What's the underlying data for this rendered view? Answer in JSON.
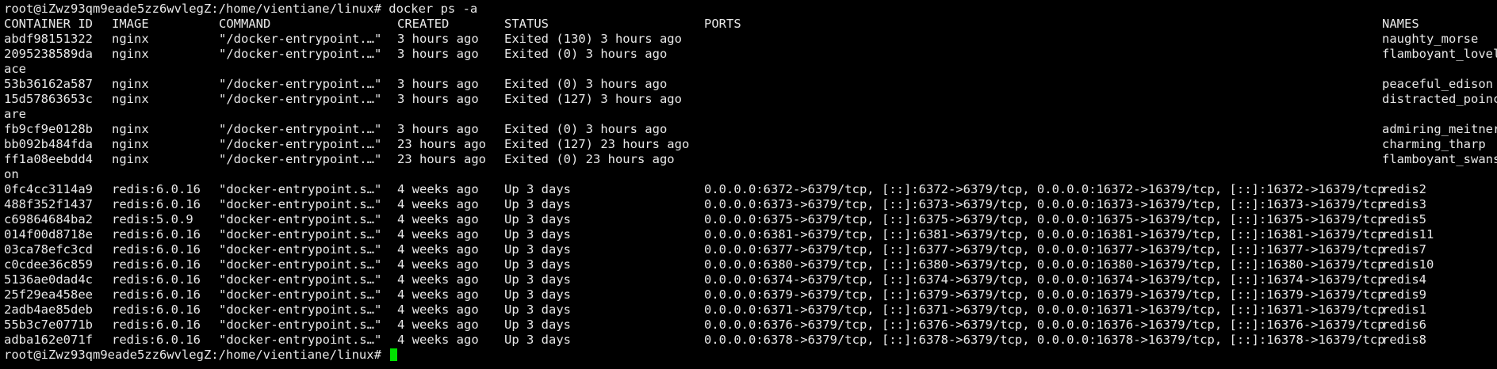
{
  "colors": {
    "background": "#000000",
    "foreground": "#e8e8e8",
    "cursor": "#00e000"
  },
  "prompt": "root@iZwz93qm9eade5zz6wvlegZ:/home/vientiane/linux#",
  "command": "docker ps -a",
  "headers": {
    "id": "CONTAINER ID",
    "image": "IMAGE",
    "command": "COMMAND",
    "created": "CREATED",
    "status": "STATUS",
    "ports": "PORTS",
    "names": "NAMES"
  },
  "rows": [
    {
      "id": "abdf98151322",
      "image": "nginx",
      "command": "\"/docker-entrypoint.…\"",
      "created": "3 hours ago",
      "status": "Exited (130) 3 hours ago",
      "ports": "",
      "names": "naughty_morse",
      "wrap": ""
    },
    {
      "id": "2095238589da",
      "image": "nginx",
      "command": "\"/docker-entrypoint.…\"",
      "created": "3 hours ago",
      "status": "Exited (0) 3 hours ago",
      "ports": "",
      "names": "flamboyant_lovel",
      "wrap": "ace"
    },
    {
      "id": "53b36162a587",
      "image": "nginx",
      "command": "\"/docker-entrypoint.…\"",
      "created": "3 hours ago",
      "status": "Exited (0) 3 hours ago",
      "ports": "",
      "names": "peaceful_edison",
      "wrap": ""
    },
    {
      "id": "15d57863653c",
      "image": "nginx",
      "command": "\"/docker-entrypoint.…\"",
      "created": "3 hours ago",
      "status": "Exited (127) 3 hours ago",
      "ports": "",
      "names": "distracted_poinc",
      "wrap": "are"
    },
    {
      "id": "fb9cf9e0128b",
      "image": "nginx",
      "command": "\"/docker-entrypoint.…\"",
      "created": "3 hours ago",
      "status": "Exited (0) 3 hours ago",
      "ports": "",
      "names": "admiring_meitner",
      "wrap": ""
    },
    {
      "id": "bb092b484fda",
      "image": "nginx",
      "command": "\"/docker-entrypoint.…\"",
      "created": "23 hours ago",
      "status": "Exited (127) 23 hours ago",
      "ports": "",
      "names": "charming_tharp",
      "wrap": ""
    },
    {
      "id": "ff1a08eebdd4",
      "image": "nginx",
      "command": "\"/docker-entrypoint.…\"",
      "created": "23 hours ago",
      "status": "Exited (0) 23 hours ago",
      "ports": "",
      "names": "flamboyant_swans",
      "wrap": "on"
    },
    {
      "id": "0fc4cc3114a9",
      "image": "redis:6.0.16",
      "command": "\"docker-entrypoint.s…\"",
      "created": "4 weeks ago",
      "status": "Up 3 days",
      "ports": "0.0.0.0:6372->6379/tcp, [::]:6372->6379/tcp, 0.0.0.0:16372->16379/tcp, [::]:16372->16379/tcp",
      "names": "redis2",
      "wrap": ""
    },
    {
      "id": "488f352f1437",
      "image": "redis:6.0.16",
      "command": "\"docker-entrypoint.s…\"",
      "created": "4 weeks ago",
      "status": "Up 3 days",
      "ports": "0.0.0.0:6373->6379/tcp, [::]:6373->6379/tcp, 0.0.0.0:16373->16379/tcp, [::]:16373->16379/tcp",
      "names": "redis3",
      "wrap": ""
    },
    {
      "id": "c69864684ba2",
      "image": "redis:5.0.9",
      "command": "\"docker-entrypoint.s…\"",
      "created": "4 weeks ago",
      "status": "Up 3 days",
      "ports": "0.0.0.0:6375->6379/tcp, [::]:6375->6379/tcp, 0.0.0.0:16375->16379/tcp, [::]:16375->16379/tcp",
      "names": "redis5",
      "wrap": ""
    },
    {
      "id": "014f00d8718e",
      "image": "redis:6.0.16",
      "command": "\"docker-entrypoint.s…\"",
      "created": "4 weeks ago",
      "status": "Up 3 days",
      "ports": "0.0.0.0:6381->6379/tcp, [::]:6381->6379/tcp, 0.0.0.0:16381->16379/tcp, [::]:16381->16379/tcp",
      "names": "redis11",
      "wrap": ""
    },
    {
      "id": "03ca78efc3cd",
      "image": "redis:6.0.16",
      "command": "\"docker-entrypoint.s…\"",
      "created": "4 weeks ago",
      "status": "Up 3 days",
      "ports": "0.0.0.0:6377->6379/tcp, [::]:6377->6379/tcp, 0.0.0.0:16377->16379/tcp, [::]:16377->16379/tcp",
      "names": "redis7",
      "wrap": ""
    },
    {
      "id": "c0cdee36c859",
      "image": "redis:6.0.16",
      "command": "\"docker-entrypoint.s…\"",
      "created": "4 weeks ago",
      "status": "Up 3 days",
      "ports": "0.0.0.0:6380->6379/tcp, [::]:6380->6379/tcp, 0.0.0.0:16380->16379/tcp, [::]:16380->16379/tcp",
      "names": "redis10",
      "wrap": ""
    },
    {
      "id": "5136ae0dad4c",
      "image": "redis:6.0.16",
      "command": "\"docker-entrypoint.s…\"",
      "created": "4 weeks ago",
      "status": "Up 3 days",
      "ports": "0.0.0.0:6374->6379/tcp, [::]:6374->6379/tcp, 0.0.0.0:16374->16379/tcp, [::]:16374->16379/tcp",
      "names": "redis4",
      "wrap": ""
    },
    {
      "id": "25f29ea458ee",
      "image": "redis:6.0.16",
      "command": "\"docker-entrypoint.s…\"",
      "created": "4 weeks ago",
      "status": "Up 3 days",
      "ports": "0.0.0.0:6379->6379/tcp, [::]:6379->6379/tcp, 0.0.0.0:16379->16379/tcp, [::]:16379->16379/tcp",
      "names": "redis9",
      "wrap": ""
    },
    {
      "id": "2adb4ae85deb",
      "image": "redis:6.0.16",
      "command": "\"docker-entrypoint.s…\"",
      "created": "4 weeks ago",
      "status": "Up 3 days",
      "ports": "0.0.0.0:6371->6379/tcp, [::]:6371->6379/tcp, 0.0.0.0:16371->16379/tcp, [::]:16371->16379/tcp",
      "names": "redis1",
      "wrap": ""
    },
    {
      "id": "55b3c7e0771b",
      "image": "redis:6.0.16",
      "command": "\"docker-entrypoint.s…\"",
      "created": "4 weeks ago",
      "status": "Up 3 days",
      "ports": "0.0.0.0:6376->6379/tcp, [::]:6376->6379/tcp, 0.0.0.0:16376->16379/tcp, [::]:16376->16379/tcp",
      "names": "redis6",
      "wrap": ""
    },
    {
      "id": "adba162e071f",
      "image": "redis:6.0.16",
      "command": "\"docker-entrypoint.s…\"",
      "created": "4 weeks ago",
      "status": "Up 3 days",
      "ports": "0.0.0.0:6378->6379/tcp, [::]:6378->6379/tcp, 0.0.0.0:16378->16379/tcp, [::]:16378->16379/tcp",
      "names": "redis8",
      "wrap": ""
    }
  ]
}
